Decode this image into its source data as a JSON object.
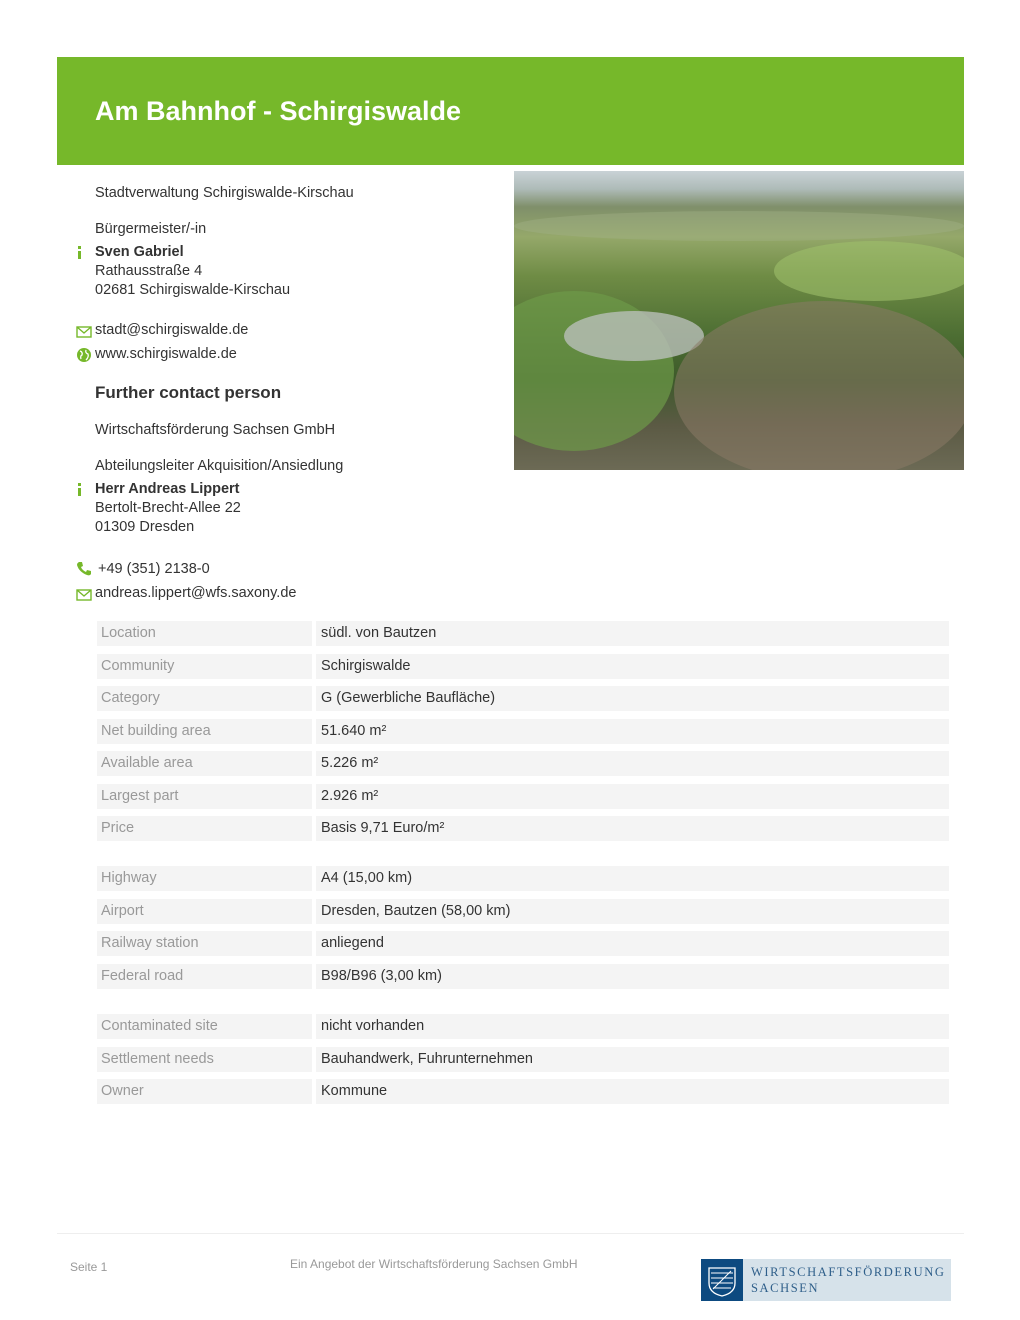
{
  "title": "Am Bahnhof - Schirgiswalde",
  "contact": {
    "organization": "Stadtverwaltung Schirgiswalde-Kirschau",
    "role": "Bürgermeister/-in",
    "name": "Sven Gabriel",
    "street": "Rathausstraße 4",
    "city": "02681 Schirgiswalde-Kirschau",
    "email": "stadt@schirgiswalde.de",
    "web": "www.schirgiswalde.de"
  },
  "further": {
    "heading": "Further contact person",
    "organization": "Wirtschaftsförderung Sachsen GmbH",
    "role": "Abteilungsleiter Akquisition/Ansiedlung",
    "name": "Herr Andreas Lippert",
    "street": "Bertolt-Brecht-Allee 22",
    "city": "01309 Dresden",
    "phone": "+49 (351) 2138-0",
    "email": "andreas.lippert@wfs.saxony.de"
  },
  "details": [
    {
      "label": "Location",
      "value": "südl. von Bautzen"
    },
    {
      "label": "Community",
      "value": "Schirgiswalde"
    },
    {
      "label": "Category",
      "value": "G (Gewerbliche Baufläche)"
    },
    {
      "label": "Net building area",
      "value": "51.640 m²"
    },
    {
      "label": "Available area",
      "value": "5.226 m²"
    },
    {
      "label": "Largest part",
      "value": "2.926 m²"
    },
    {
      "label": "Price",
      "value": "Basis 9,71 Euro/m²"
    },
    {
      "label": "Highway",
      "value": "A4 (15,00 km)"
    },
    {
      "label": "Airport",
      "value": "Dresden, Bautzen (58,00 km)"
    },
    {
      "label": "Railway station",
      "value": "anliegend"
    },
    {
      "label": "Federal road",
      "value": "B98/B96 (3,00 km)"
    },
    {
      "label": "Contaminated site",
      "value": "nicht vorhanden"
    },
    {
      "label": "Settlement needs",
      "value": "Bauhandwerk, Fuhrunternehmen"
    },
    {
      "label": "Owner",
      "value": "Kommune"
    }
  ],
  "footer": {
    "page": "Seite 1",
    "offer": "Ein Angebot der Wirtschaftsförderung Sachsen GmbH",
    "logo_line1": "WIRTSCHAFTSFÖRDERUNG",
    "logo_line2": "SACHSEN"
  },
  "colors": {
    "accent": "#76b82a",
    "logo_blue": "#0d4a80"
  }
}
